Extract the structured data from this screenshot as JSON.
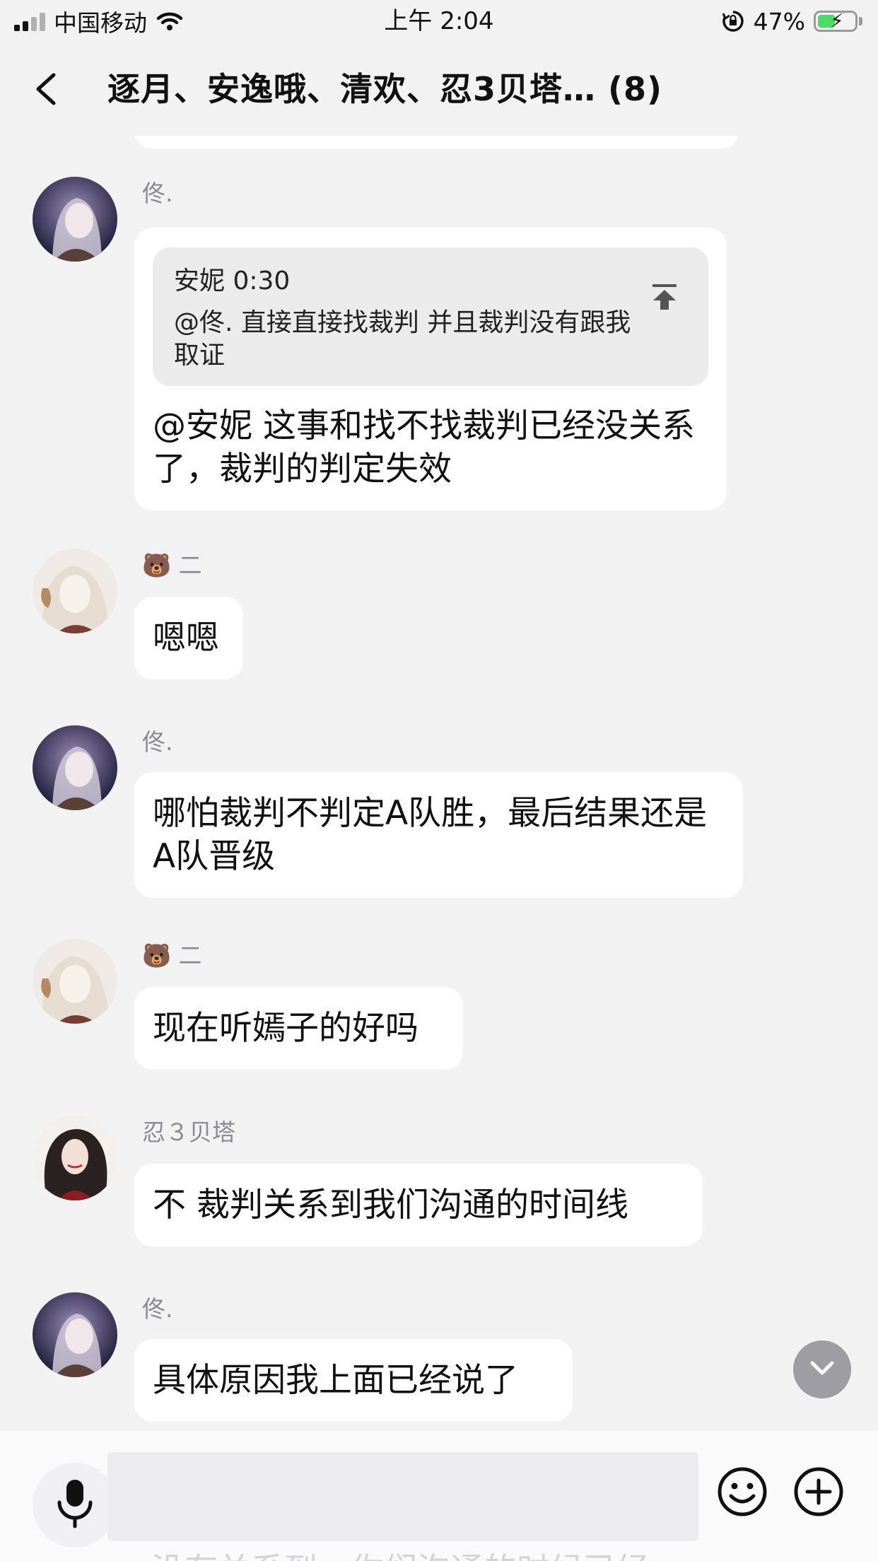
{
  "status_bar": {
    "carrier": "中国移动",
    "time": "上午 2:04",
    "battery": "47%",
    "battery_level": 0.47
  },
  "header": {
    "title": "逐月、安逸哦、清欢、忍3贝塔… (8)"
  },
  "messages": [
    {
      "sender": "佟.",
      "quote": {
        "author_time": "安妮 0:30",
        "text": "@佟. 直接直接找裁判 并且裁判没有跟我取证"
      },
      "text": "@安妮 这事和找不找裁判已经没关系了，裁判的判定失效"
    },
    {
      "sender_emoji": "🐻",
      "sender": "二",
      "text": "嗯嗯"
    },
    {
      "sender": "佟.",
      "text": "哪怕裁判不判定A队胜，最后结果还是A队晋级"
    },
    {
      "sender_emoji": "🐻",
      "sender": "二",
      "text": "现在听嫣子的好吗"
    },
    {
      "sender": "忍３贝塔",
      "text": "不 裁判关系到我们沟通的时间线"
    },
    {
      "sender": "佟.",
      "text": "具体原因我上面已经说了"
    }
  ],
  "input": {
    "value": "",
    "ghost_text": "没有关系到，你们沟通的时候已经"
  },
  "icons": [
    "back-icon",
    "mic-icon",
    "emoji-icon",
    "plus-icon",
    "scroll-down-icon",
    "scroll-top-icon",
    "wifi-icon",
    "rotation-lock-icon"
  ]
}
